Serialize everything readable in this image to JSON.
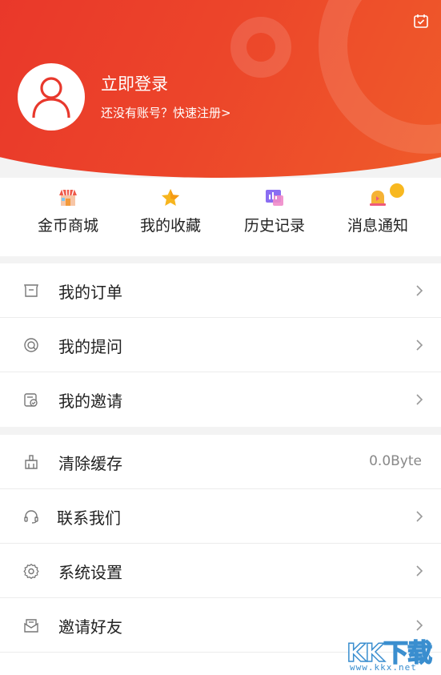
{
  "header": {
    "login_title": "立即登录",
    "register_prompt": "还没有账号？快速注册>",
    "colors": {
      "gradient_start": "#e8322a",
      "gradient_end": "#f0602a"
    }
  },
  "quick_actions": [
    {
      "label": "金币商城",
      "icon": "shop-icon"
    },
    {
      "label": "我的收藏",
      "icon": "star-icon"
    },
    {
      "label": "历史记录",
      "icon": "history-chart-icon"
    },
    {
      "label": "消息通知",
      "icon": "bell-icon",
      "badge": true
    }
  ],
  "menu_group_1": [
    {
      "label": "我的订单",
      "icon": "order-icon"
    },
    {
      "label": "我的提问",
      "icon": "question-icon"
    },
    {
      "label": "我的邀请",
      "icon": "invite-icon"
    }
  ],
  "menu_group_2": [
    {
      "label": "清除缓存",
      "icon": "broom-icon",
      "value": "0.0Byte"
    },
    {
      "label": "联系我们",
      "icon": "headset-icon"
    },
    {
      "label": "系统设置",
      "icon": "gear-icon"
    },
    {
      "label": "邀请好友",
      "icon": "mail-icon"
    }
  ],
  "watermark": {
    "text": "KK下载",
    "url": "www.kkx.net"
  }
}
